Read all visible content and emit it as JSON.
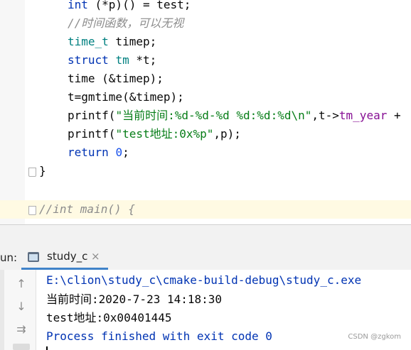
{
  "editor": {
    "lines": [
      {
        "id": "l1",
        "parts": [
          [
            "kw",
            "int "
          ],
          [
            "",
            "(*p)() = test;"
          ]
        ]
      },
      {
        "id": "l2",
        "parts": [
          [
            "cm",
            "//时间函数，可以无视"
          ]
        ]
      },
      {
        "id": "l3",
        "parts": [
          [
            "ty",
            "time_t"
          ],
          [
            "",
            " timep;"
          ]
        ]
      },
      {
        "id": "l4",
        "parts": [
          [
            "kw",
            "struct "
          ],
          [
            "ty",
            "tm"
          ],
          [
            "",
            " *t;"
          ]
        ]
      },
      {
        "id": "l5",
        "parts": [
          [
            "",
            "time (&timep);"
          ]
        ]
      },
      {
        "id": "l6",
        "parts": [
          [
            "",
            "t=gmtime(&timep);"
          ]
        ]
      },
      {
        "id": "l7",
        "parts": [
          [
            "",
            "printf("
          ],
          [
            "st",
            "\"当前时间:%d-%d-%d %d:%d:%d\\n\""
          ],
          [
            "",
            ",t->"
          ],
          [
            "pu",
            "tm_year"
          ],
          [
            "",
            " +"
          ]
        ]
      },
      {
        "id": "l8",
        "parts": [
          [
            "",
            "printf("
          ],
          [
            "st",
            "\"test地址:0x%p\""
          ],
          [
            "",
            ",p);"
          ]
        ]
      },
      {
        "id": "l9",
        "parts": [
          [
            "kw",
            "return "
          ],
          [
            "nu",
            "0"
          ],
          [
            "",
            ";"
          ]
        ]
      },
      {
        "id": "l10",
        "parts": [
          [
            "",
            "}"
          ]
        ]
      },
      {
        "id": "l11",
        "parts": [
          [
            "cm",
            "//int main() {"
          ]
        ]
      }
    ]
  },
  "run": {
    "label": "un:",
    "tab_title": "study_c",
    "tab_close": "×"
  },
  "console": {
    "path_line": "E:\\clion\\study_c\\cmake-build-debug\\study_c.exe",
    "output_1": "当前时间:2020-7-23 14:18:30",
    "output_2": "test地址:0x00401445",
    "finished": "Process finished with exit code 0",
    "buttons": [
      "up-arrow-icon",
      "down-arrow-icon",
      "soft-wrap-icon",
      "scroll-end-icon"
    ]
  },
  "watermark": "CSDN @zgkom",
  "colors": {
    "keyword": "#0033b3",
    "type": "#008080",
    "string": "#067d17",
    "comment": "#8c8c8c",
    "field": "#871094",
    "number": "#1750eb",
    "tab_underline": "#4083c9"
  }
}
